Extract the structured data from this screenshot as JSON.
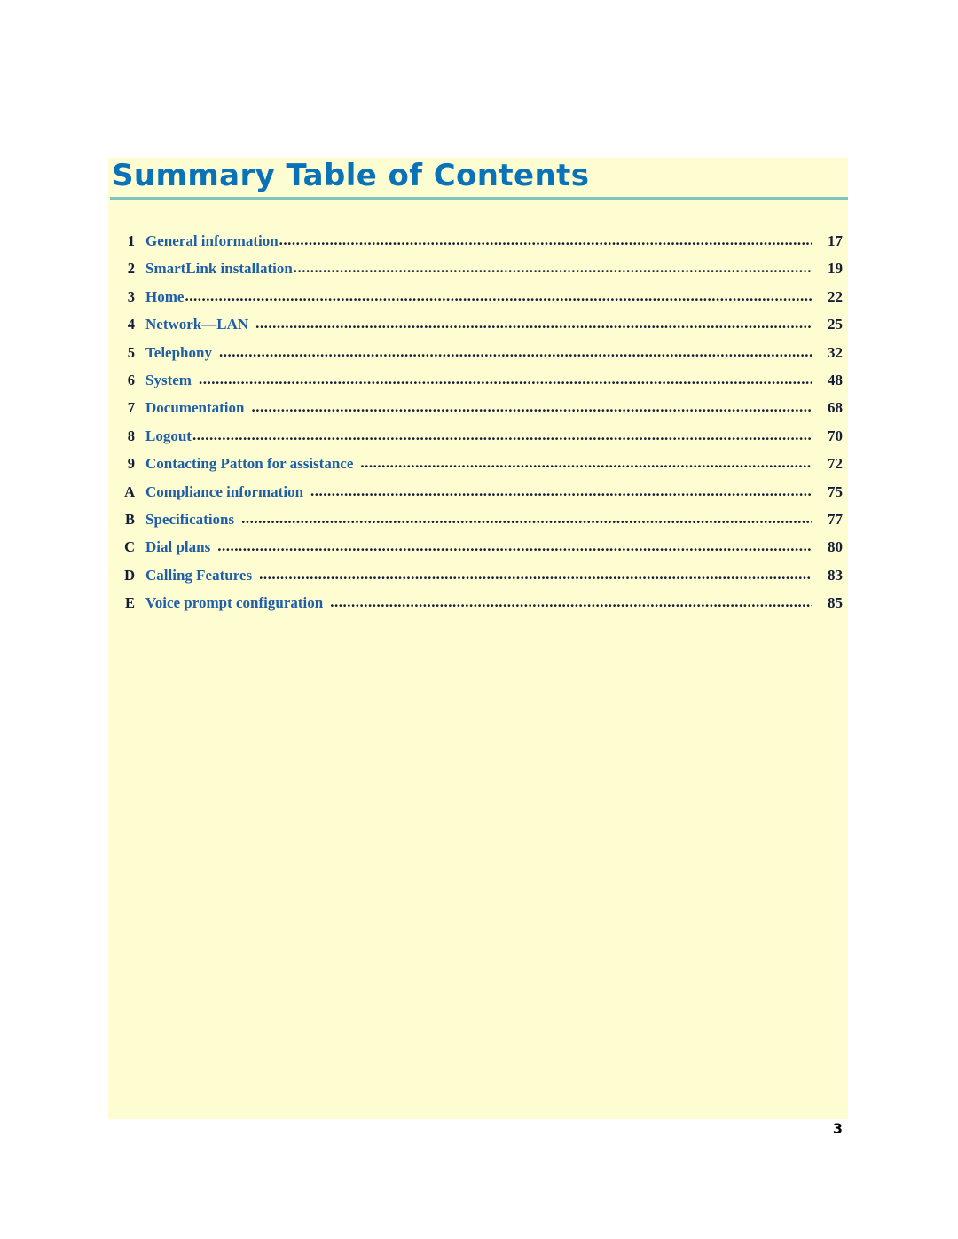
{
  "page": {
    "title": "Summary Table of Contents",
    "folio": "3",
    "colors": {
      "panel_background": "#fdfdd1",
      "title_blue": "#0a72b9",
      "entry_blue": "#1f5fa9",
      "rule_teal": "#7cc4bd",
      "number_ink": "#131c38",
      "page_background": "#ffffff"
    }
  },
  "toc": {
    "leader": "....................................................................................................................................................................................",
    "entries": [
      {
        "number": "1",
        "label": "General information",
        "page": "17",
        "space_before_dots": false
      },
      {
        "number": "2",
        "label": "SmartLink installation",
        "page": "19",
        "space_before_dots": false
      },
      {
        "number": "3",
        "label": "Home",
        "page": "22",
        "space_before_dots": false
      },
      {
        "number": "4",
        "label": "Network—LAN",
        "page": "25",
        "space_before_dots": true
      },
      {
        "number": "5",
        "label": "Telephony",
        "page": "32",
        "space_before_dots": true
      },
      {
        "number": "6",
        "label": "System",
        "page": "48",
        "space_before_dots": true
      },
      {
        "number": "7",
        "label": "Documentation",
        "page": "68",
        "space_before_dots": true
      },
      {
        "number": "8",
        "label": "Logout",
        "page": "70",
        "space_before_dots": false
      },
      {
        "number": "9",
        "label": "Contacting Patton for assistance",
        "page": "72",
        "space_before_dots": true
      },
      {
        "number": "A",
        "label": "Compliance information",
        "page": "75",
        "space_before_dots": true
      },
      {
        "number": "B",
        "label": "Specifications",
        "page": "77",
        "space_before_dots": true
      },
      {
        "number": "C",
        "label": "Dial plans",
        "page": "80",
        "space_before_dots": true
      },
      {
        "number": "D",
        "label": "Calling Features",
        "page": "83",
        "space_before_dots": true
      },
      {
        "number": "E",
        "label": "Voice prompt configuration",
        "page": "85",
        "space_before_dots": true
      }
    ]
  }
}
